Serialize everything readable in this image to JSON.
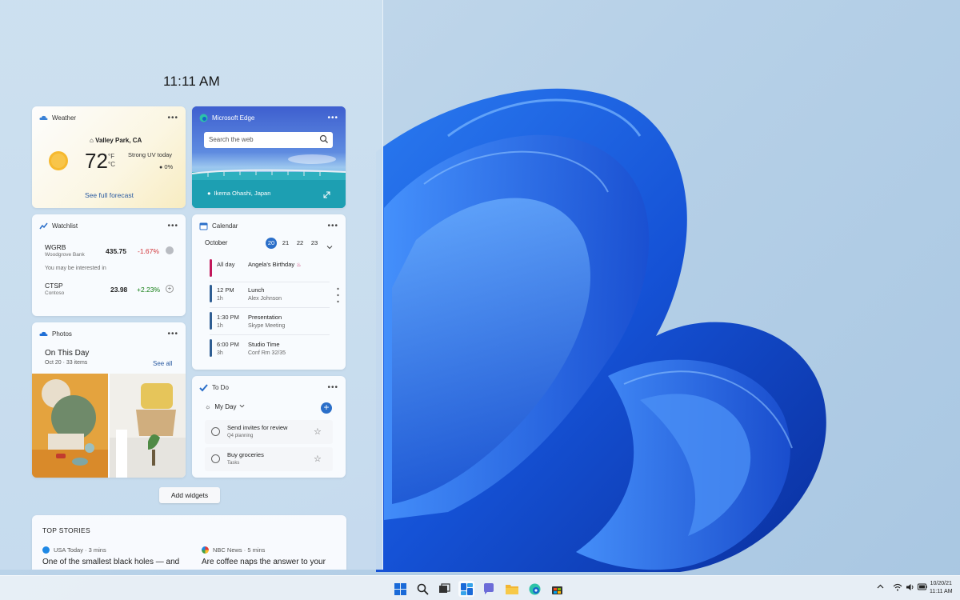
{
  "clock": "11:11 AM",
  "weather": {
    "title": "Weather",
    "location": "Valley Park, CA",
    "temperature": "72",
    "unit_f": "°F",
    "unit_c": "°C",
    "condition": "Strong UV today",
    "precipitation": "0%",
    "link": "See full forecast"
  },
  "edge": {
    "title": "Microsoft Edge",
    "search_placeholder": "Search the web",
    "caption": "Ikema Ohashi, Japan"
  },
  "watchlist": {
    "title": "Watchlist",
    "stocks": [
      {
        "symbol": "WGRB",
        "company": "Woodgrove Bank",
        "price": "435.75",
        "change": "-1.67%",
        "direction": "down"
      },
      {
        "symbol": "CTSP",
        "company": "Contoso",
        "price": "23.98",
        "change": "+2.23%",
        "direction": "up"
      }
    ],
    "interested_label": "You may be interested in"
  },
  "calendar": {
    "title": "Calendar",
    "month": "October",
    "days": [
      "20",
      "21",
      "22",
      "23"
    ],
    "selected_day": "20",
    "events": [
      {
        "time": "All day",
        "duration": "",
        "name": "Angela's Birthday",
        "detail": "",
        "color": "#c2185b"
      },
      {
        "time": "12 PM",
        "duration": "1h",
        "name": "Lunch",
        "detail": "Alex  Johnson",
        "color": "#2f5e93"
      },
      {
        "time": "1:30 PM",
        "duration": "1h",
        "name": "Presentation",
        "detail": "Skype Meeting",
        "color": "#2f5e93"
      },
      {
        "time": "6:00 PM",
        "duration": "3h",
        "name": "Studio Time",
        "detail": "Conf Rm 32/35",
        "color": "#2f5e93"
      }
    ]
  },
  "photos": {
    "title": "Photos",
    "heading": "On This Day",
    "subheading": "Oct 20 · 33 items",
    "see_all": "See all"
  },
  "todo": {
    "title": "To Do",
    "list_name": "My Day",
    "tasks": [
      {
        "title": "Send invites for review",
        "list": "Q4 planning"
      },
      {
        "title": "Buy groceries",
        "list": "Tasks"
      }
    ]
  },
  "add_widgets": "Add widgets",
  "top_stories": {
    "heading": "TOP STORIES",
    "items": [
      {
        "source": "USA Today · 3 mins",
        "title": "One of the smallest black holes — and",
        "color": "#1e88e5"
      },
      {
        "source": "NBC News · 5 mins",
        "title": "Are coffee naps the answer to your",
        "color": "#e53935"
      }
    ]
  },
  "taskbar": {
    "icons": [
      "windows-start-icon",
      "search-icon",
      "task-view-icon",
      "widgets-icon",
      "chat-icon",
      "file-explorer-icon",
      "edge-icon",
      "store-icon"
    ],
    "tray_caret": "^",
    "date": "10/20/21",
    "time": "11:11 AM"
  },
  "colors": {
    "accent": "#2b6fc9",
    "negative": "#d13438",
    "positive": "#107c10",
    "bloom": "#1a5fd8"
  }
}
